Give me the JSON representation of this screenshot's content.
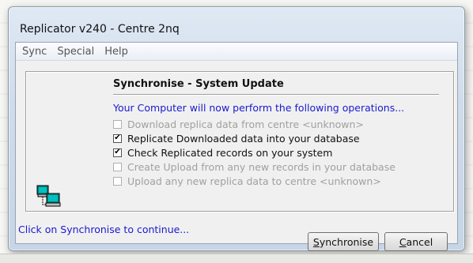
{
  "window": {
    "title": "Replicator v240 - Centre 2nq"
  },
  "menu": {
    "items": [
      "Sync",
      "Special",
      "Help"
    ]
  },
  "panel": {
    "title": "Synchronise - System Update",
    "intro": "Your Computer will now perform the following operations...",
    "operations": [
      {
        "label": "Download replica data from centre <unknown>",
        "checked": false,
        "enabled": false
      },
      {
        "label": "Replicate Downloaded data into your database",
        "checked": true,
        "enabled": true
      },
      {
        "label": "Check Replicated records on your system",
        "checked": true,
        "enabled": true
      },
      {
        "label": "Create Upload from any new records in your database",
        "checked": false,
        "enabled": false
      },
      {
        "label": "Upload any new replica data to centre <unknown>",
        "checked": false,
        "enabled": false
      }
    ]
  },
  "status": {
    "text": "Click on Synchronise to continue..."
  },
  "buttons": {
    "synchronise": {
      "mnemonic": "S",
      "rest": "ynchronise"
    },
    "cancel": {
      "mnemonic": "C",
      "rest": "ancel"
    }
  },
  "icons": {
    "computer": "network-computers-icon",
    "check": "checkmark-icon"
  },
  "colors": {
    "link_blue": "#1a1ad0",
    "disabled_gray": "#a0a0a0"
  }
}
